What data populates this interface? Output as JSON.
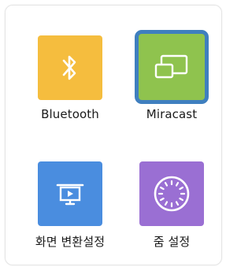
{
  "tiles": [
    {
      "id": "bluetooth",
      "label": "Bluetooth",
      "icon": "bluetooth-icon",
      "color": "#f5bd3e",
      "selected": false
    },
    {
      "id": "miracast",
      "label": "Miracast",
      "icon": "screen-cast-icon",
      "color": "#8fc34e",
      "selected": true,
      "focus_color": "#3f7fbf"
    },
    {
      "id": "screen-convert",
      "label": "화면 변환설정",
      "icon": "projector-screen-icon",
      "color": "#4a8ddf",
      "selected": false
    },
    {
      "id": "zoom",
      "label": "줌 설정",
      "icon": "dial-icon",
      "color": "#9a6fd3",
      "selected": false
    }
  ]
}
